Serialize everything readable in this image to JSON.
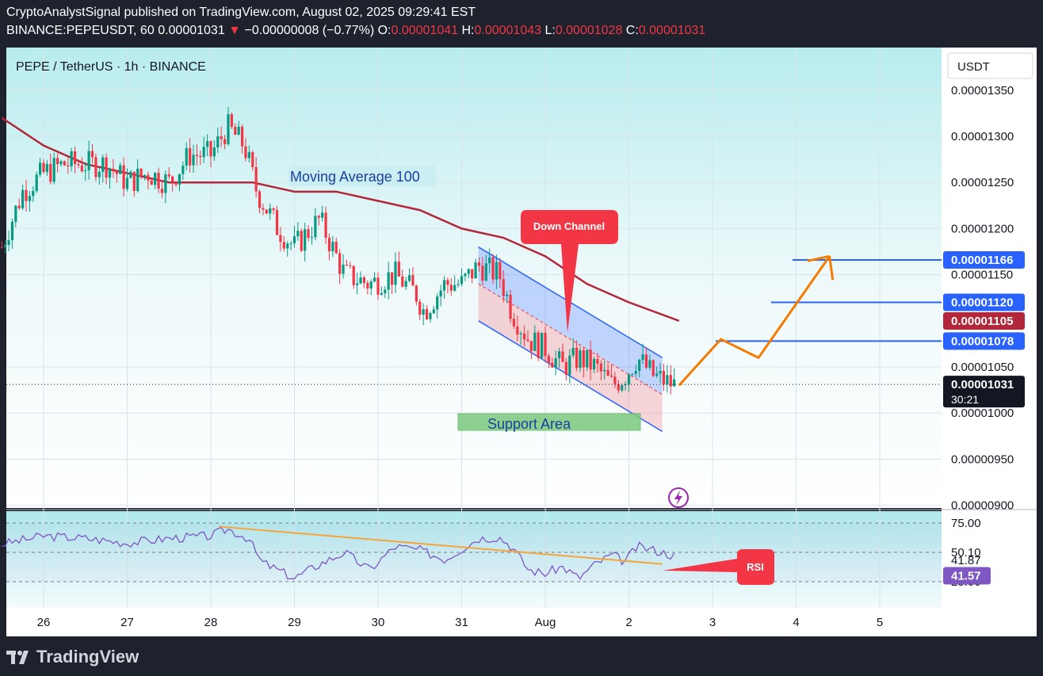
{
  "header": {
    "publisher_line": "CryptoAnalystSignal published on TradingView.com, August 02, 2025 09:29:41 EST",
    "symbol": "BINANCE:PEPEUSDT, 60",
    "last": "0.00001031",
    "arrow": "▼",
    "change": "−0.00000008 (−0.77%)",
    "o_label": "O:",
    "o_value": "0.00001041",
    "h_label": "H:",
    "h_value": "0.00001043",
    "l_label": "L:",
    "l_value": "0.00001028",
    "c_label": "C:",
    "c_value": "0.00001031"
  },
  "legend_title": "PEPE / TetherUS · 1h · BINANCE",
  "currency_button": "USDT",
  "annotations": {
    "moving_average": "Moving Average 100",
    "down_channel": "Down Channel",
    "support_area": "Support Area",
    "rsi": "RSI"
  },
  "price_badges": {
    "level_1": "0.00001166",
    "level_2": "0.00001120",
    "ma_value": "0.00001105",
    "level_3": "0.00001078",
    "current": "0.00001031",
    "countdown": "30:21"
  },
  "rsi_badges": {
    "rsi_ma": "41.87",
    "rsi": "41.57"
  },
  "footer": {
    "brand": "TradingView"
  },
  "colors": {
    "background": "#ffffff",
    "bull": "#089981",
    "bear": "#f23645",
    "ma": "#b2283a",
    "level_line": "#2962ff",
    "projection": "#f57c00",
    "rsi": "#7e57c2",
    "rsi_trend": "#f7a43a"
  },
  "chart_data": [
    {
      "type": "candlestick",
      "title": "PEPE / TetherUS · 1h · BINANCE",
      "x_ticks": [
        "26",
        "27",
        "28",
        "29",
        "30",
        "31",
        "Aug",
        "2",
        "3",
        "4",
        "5"
      ],
      "y_ticks": [
        "0.00001350",
        "0.00001300",
        "0.00001250",
        "0.00001200",
        "0.00001150",
        "0.00001050",
        "0.00001000",
        "0.00000950",
        "0.00000900"
      ],
      "y_tick_values": [
        1.35e-05,
        1.3e-05,
        1.25e-05,
        1.2e-05,
        1.15e-05,
        1.05e-05,
        1e-05,
        9.5e-06,
        9e-06
      ],
      "ylim": [
        8.9e-06,
        1.39e-05
      ],
      "anchors_day_close": [
        [
          25.5,
          1.18e-05
        ],
        [
          25.75,
          1.24e-05
        ],
        [
          26.0,
          1.26e-05
        ],
        [
          26.25,
          1.27e-05
        ],
        [
          26.5,
          1.27e-05
        ],
        [
          26.75,
          1.27e-05
        ],
        [
          27.0,
          1.25e-05
        ],
        [
          27.25,
          1.26e-05
        ],
        [
          27.5,
          1.25e-05
        ],
        [
          27.75,
          1.28e-05
        ],
        [
          28.0,
          1.28e-05
        ],
        [
          28.2,
          1.31e-05
        ],
        [
          28.4,
          1.29e-05
        ],
        [
          28.55,
          1.24e-05
        ],
        [
          28.8,
          1.2e-05
        ],
        [
          29.0,
          1.18e-05
        ],
        [
          29.3,
          1.21e-05
        ],
        [
          29.6,
          1.15e-05
        ],
        [
          29.9,
          1.14e-05
        ],
        [
          30.2,
          1.15e-05
        ],
        [
          30.45,
          1.13e-05
        ],
        [
          30.55,
          1.11e-05
        ],
        [
          30.8,
          1.14e-05
        ],
        [
          31.0,
          1.14e-05
        ],
        [
          31.2,
          1.16e-05
        ],
        [
          31.45,
          1.15e-05
        ],
        [
          31.6,
          1.11e-05
        ],
        [
          31.8,
          1.08e-05
        ],
        [
          32.0,
          1.07e-05
        ],
        [
          32.2,
          1.05e-05
        ],
        [
          32.4,
          1.06e-05
        ],
        [
          32.6,
          1.05e-05
        ],
        [
          32.8,
          1.03e-05
        ],
        [
          32.95,
          1.04e-05
        ],
        [
          33.1,
          1.06e-05
        ],
        [
          33.3,
          1.04e-05
        ],
        [
          33.55,
          1.03e-05
        ]
      ],
      "moving_average_100": [
        [
          25.5,
          1.32e-05
        ],
        [
          26.0,
          1.29e-05
        ],
        [
          26.5,
          1.27e-05
        ],
        [
          27.0,
          1.26e-05
        ],
        [
          27.5,
          1.25e-05
        ],
        [
          28.0,
          1.25e-05
        ],
        [
          28.5,
          1.25e-05
        ],
        [
          29.0,
          1.24e-05
        ],
        [
          29.5,
          1.24e-05
        ],
        [
          30.0,
          1.23e-05
        ],
        [
          30.5,
          1.22e-05
        ],
        [
          31.0,
          1.2e-05
        ],
        [
          31.5,
          1.19e-05
        ],
        [
          32.0,
          1.17e-05
        ],
        [
          32.5,
          1.14e-05
        ],
        [
          33.0,
          1.12e-05
        ],
        [
          33.6,
          1.1e-05
        ]
      ],
      "down_channel": {
        "upper": [
          [
            31.2,
            1.18e-05
          ],
          [
            33.4,
            1.06e-05
          ]
        ],
        "lower": [
          [
            31.2,
            1.1e-05
          ],
          [
            33.4,
            9.8e-06
          ]
        ],
        "mid": [
          [
            31.2,
            1.14e-05
          ],
          [
            33.4,
            1.02e-05
          ]
        ]
      },
      "support_area": [
        9.9e-06,
        1.01e-05
      ],
      "horizontal_levels": [
        1.166e-05,
        1.12e-05,
        1.078e-05
      ],
      "projection_path": [
        [
          33.6,
          1.03e-05
        ],
        [
          34.1,
          1.08e-05
        ],
        [
          34.55,
          1.06e-05
        ],
        [
          35.4,
          1.17e-05
        ]
      ],
      "current_price": 1.031e-05
    },
    {
      "type": "line",
      "title": "RSI",
      "y_ticks": [
        "75.00",
        "50.10",
        "25.00"
      ],
      "y_tick_values": [
        75,
        50,
        25
      ],
      "ylim": [
        15,
        80
      ],
      "rsi_anchors": [
        [
          25.5,
          57
        ],
        [
          26.0,
          64
        ],
        [
          26.5,
          62
        ],
        [
          27.0,
          58
        ],
        [
          27.5,
          62
        ],
        [
          28.0,
          64
        ],
        [
          28.2,
          70
        ],
        [
          28.45,
          62
        ],
        [
          28.6,
          42
        ],
        [
          29.0,
          28
        ],
        [
          29.3,
          40
        ],
        [
          29.6,
          50
        ],
        [
          29.9,
          35
        ],
        [
          30.2,
          55
        ],
        [
          30.5,
          52
        ],
        [
          30.8,
          44
        ],
        [
          31.0,
          53
        ],
        [
          31.2,
          62
        ],
        [
          31.45,
          63
        ],
        [
          31.6,
          55
        ],
        [
          31.8,
          35
        ],
        [
          32.0,
          32
        ],
        [
          32.2,
          38
        ],
        [
          32.4,
          28
        ],
        [
          32.6,
          40
        ],
        [
          32.8,
          48
        ],
        [
          32.95,
          42
        ],
        [
          33.1,
          55
        ],
        [
          33.3,
          52
        ],
        [
          33.55,
          47
        ]
      ],
      "rsi_value": 41.57,
      "rsi_ma_value": 41.87,
      "trendline": [
        [
          28.1,
          72
        ],
        [
          33.4,
          40
        ]
      ]
    }
  ]
}
